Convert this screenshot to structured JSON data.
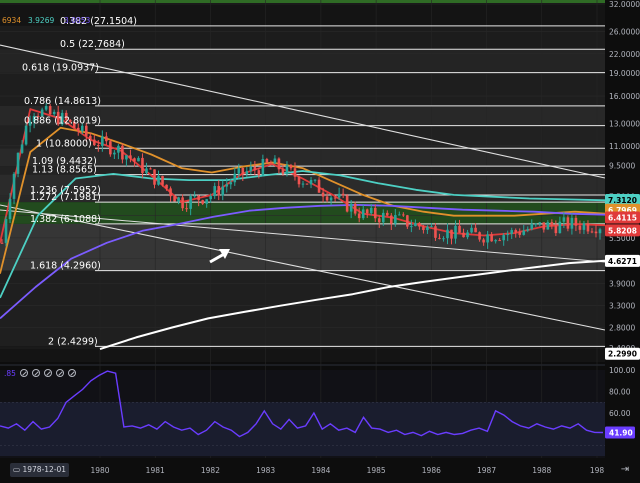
{
  "chart_data": [
    {
      "type": "candlestick",
      "scale": "log",
      "ylim": [
        2.4,
        32.0
      ],
      "xlabel": "",
      "ylabel": "",
      "x_ticks": [
        "1980",
        "1981",
        "1982",
        "1983",
        "1984",
        "1985",
        "1986",
        "1987",
        "1988",
        "198"
      ],
      "y_ticks": [
        32.0,
        26.0,
        22.0,
        19.0,
        16.0,
        13.0,
        11.0,
        9.5,
        7.5,
        6.5,
        5.5,
        4.7,
        3.9,
        3.3,
        2.8,
        2.4
      ],
      "grid": true,
      "fibonacci_levels": [
        {
          "label": "0.382 (27.1504)",
          "value": 27.1504
        },
        {
          "label": "0.5 (22.7684)",
          "value": 22.7684
        },
        {
          "label": "0.618 (19.0937)",
          "value": 19.0937
        },
        {
          "label": "0.786 (14.8613)",
          "value": 14.8613
        },
        {
          "label": "0.886 (12.8019)",
          "value": 12.8019
        },
        {
          "label": "1 (10.8000)",
          "value": 10.8
        },
        {
          "label": "1.09 (9.4432)",
          "value": 9.4432
        },
        {
          "label": "1.13 (8.8565)",
          "value": 8.8565
        },
        {
          "label": "1.236 (7.5952)",
          "value": 7.5952
        },
        {
          "label": "1.272 (7.1981)",
          "value": 7.1981
        },
        {
          "label": "1.382 (6.1088)",
          "value": 6.1088
        },
        {
          "label": "1.618 (4.2960)",
          "value": 4.296
        },
        {
          "label": "2 (2.4299)",
          "value": 2.4299
        }
      ],
      "price_tags": [
        {
          "value": "7.3120",
          "color": "#4dd0c4"
        },
        {
          "value": "6.7969",
          "color": "#e0912b"
        },
        {
          "value": "6.4115",
          "color": "#e03a3a"
        },
        {
          "value": "5.8208",
          "color": "#e03a3a"
        },
        {
          "value": "4.6271",
          "color": "#ffffff"
        },
        {
          "value": "2.2990",
          "color": "#ffffff"
        }
      ],
      "legend_values": [
        {
          "value": "6934",
          "color": "#e0912b"
        },
        {
          "value": "3.9269",
          "color": "#4dd0c4"
        },
        {
          "value": "3.0053",
          "color": "#7b5cff"
        }
      ],
      "series": [
        {
          "name": "",
          "kind": "ma",
          "color": "#e03a3a",
          "values": [
            5.3,
            14.5,
            13.5,
            11.5,
            10.6,
            8.8,
            7.2,
            7.6,
            8.9,
            9.6,
            8.6,
            7.6,
            6.6,
            6.4,
            6.0,
            5.7,
            5.6,
            5.7,
            6.0,
            6.1,
            6.05
          ]
        },
        {
          "name": "",
          "kind": "ma",
          "color": "#e0912b",
          "values": [
            4.2,
            10.5,
            12.6,
            12.1,
            11.2,
            10.3,
            9.3,
            9.0,
            9.4,
            9.7,
            9.3,
            8.4,
            7.6,
            7.0,
            6.7,
            6.5,
            6.5,
            6.5,
            6.6,
            6.7,
            6.6
          ]
        },
        {
          "name": "",
          "kind": "ma",
          "color": "#4dd0c4",
          "values": [
            3.5,
            6.5,
            8.6,
            8.9,
            8.6,
            8.5,
            8.5,
            8.8,
            9.1,
            8.8,
            8.3,
            7.9,
            7.6,
            7.5,
            7.4,
            7.35,
            7.3
          ]
        },
        {
          "name": "",
          "kind": "ma",
          "color": "#7b5cff",
          "values": [
            3.0,
            3.8,
            4.7,
            5.3,
            5.8,
            6.1,
            6.45,
            6.75,
            6.9,
            7.0,
            7.05,
            7.0,
            6.9,
            6.8,
            6.75,
            6.7,
            6.6,
            6.55
          ]
        },
        {
          "name": "",
          "kind": "ma",
          "color": "#ffffff",
          "values": [
            2.38,
            2.6,
            2.8,
            3.0,
            3.15,
            3.3,
            3.45,
            3.6,
            3.8,
            3.95,
            4.1,
            4.25,
            4.4,
            4.55,
            4.63
          ]
        }
      ]
    },
    {
      "type": "line",
      "ylim": [
        20,
        100
      ],
      "y_ticks": [
        100.0,
        80.0,
        60.0,
        40.0
      ],
      "highlighted_band": [
        20,
        70
      ],
      "current_value": "41.90",
      "value_color": "#6a3dff",
      "values": [
        48,
        46,
        50,
        44,
        52,
        45,
        47,
        55,
        70,
        76,
        82,
        90,
        95,
        99,
        97,
        47,
        48,
        46,
        49,
        45,
        52,
        47,
        44,
        46,
        40,
        44,
        52,
        47,
        44,
        38,
        42,
        50,
        62,
        50,
        45,
        54,
        46,
        48,
        60,
        45,
        50,
        44,
        46,
        42,
        56,
        46,
        45,
        42,
        44,
        40,
        42,
        39,
        43,
        40,
        42,
        40,
        41,
        44,
        46,
        43,
        62,
        58,
        52,
        48,
        46,
        50,
        47,
        45,
        48,
        46,
        50,
        44,
        42,
        41.9
      ]
    }
  ],
  "ui": {
    "start_date": "1978-12-01",
    "legend_label": ".85",
    "goto_icon": "goto-realtime-icon"
  }
}
